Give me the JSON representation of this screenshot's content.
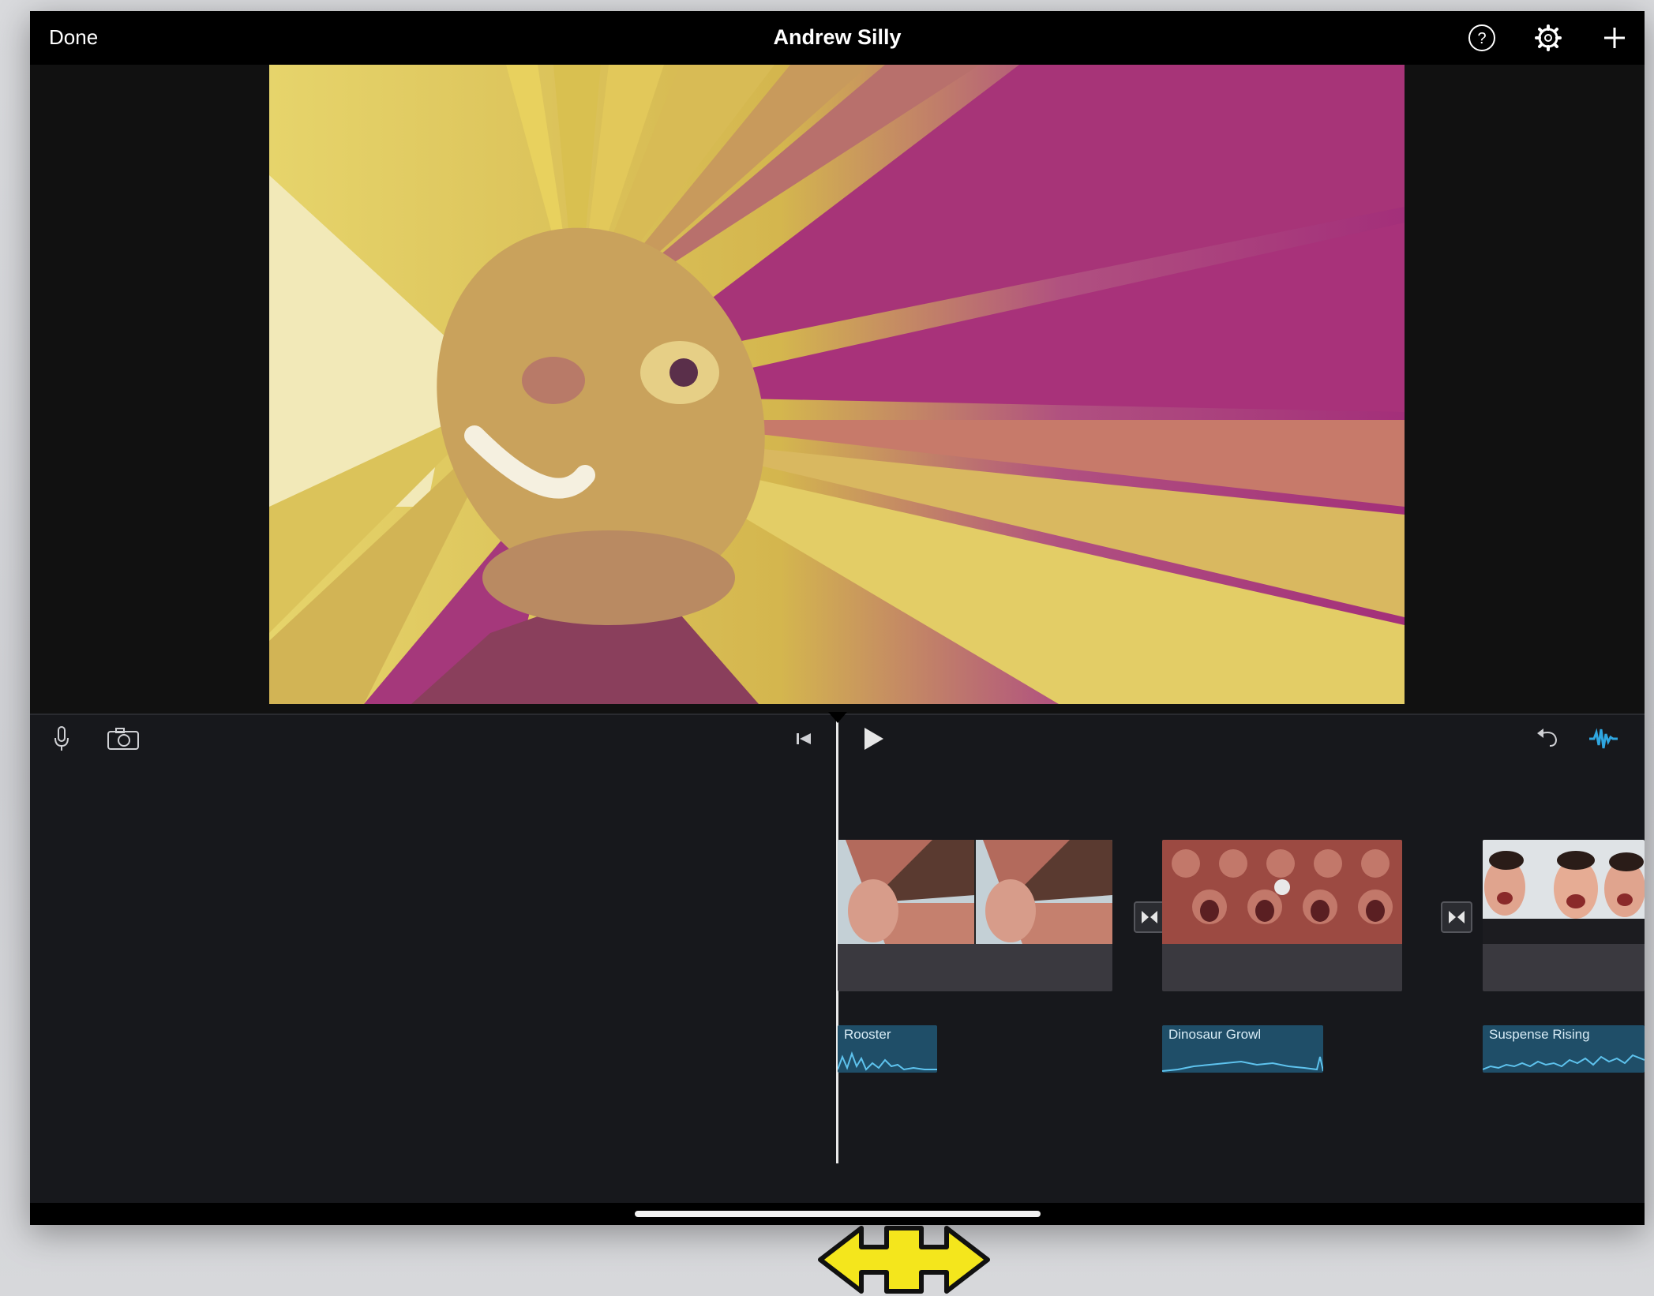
{
  "topbar": {
    "done_label": "Done",
    "title": "Andrew Silly",
    "icons": [
      "help-icon",
      "settings-icon",
      "add-icon"
    ]
  },
  "controls": {
    "left_icons": [
      "microphone-icon",
      "camera-icon"
    ],
    "center_icons": [
      "skip-to-start-icon",
      "play-icon"
    ],
    "right_icons": [
      "undo-icon",
      "audio-waveform-icon"
    ]
  },
  "timeline": {
    "clips": [
      {
        "name": "clip-1"
      },
      {
        "name": "clip-2"
      },
      {
        "name": "clip-3"
      }
    ],
    "audio_clips": [
      {
        "label": "Rooster"
      },
      {
        "label": "Dinosaur Growl"
      },
      {
        "label": "Suspense Rising"
      }
    ]
  },
  "colors": {
    "accent": "#2fa6e0",
    "audio_clip": "#1f4e68",
    "effect_yellow": "#e4cf5c",
    "effect_magenta": "#a7357c"
  }
}
